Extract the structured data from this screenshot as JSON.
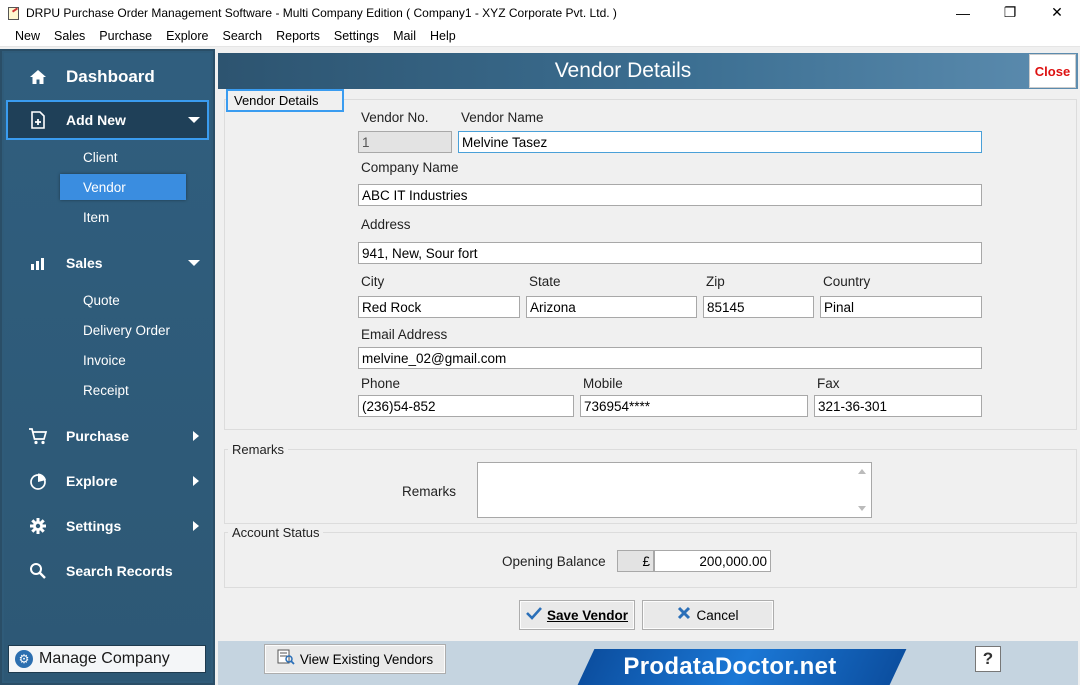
{
  "window": {
    "title": "DRPU Purchase Order Management Software - Multi Company Edition ( Company1 - XYZ Corporate Pvt. Ltd. )",
    "minimize": "—",
    "maximize": "❐",
    "close": "✕"
  },
  "menu": [
    "New",
    "Sales",
    "Purchase",
    "Explore",
    "Search",
    "Reports",
    "Settings",
    "Mail",
    "Help"
  ],
  "sidebar": {
    "dashboard": "Dashboard",
    "add_new": "Add New",
    "add_new_items": [
      "Client",
      "Vendor",
      "Item"
    ],
    "sales": "Sales",
    "sales_items": [
      "Quote",
      "Delivery Order",
      "Invoice",
      "Receipt"
    ],
    "purchase": "Purchase",
    "explore": "Explore",
    "settings": "Settings",
    "search_records": "Search Records",
    "manage_company": "Manage Company"
  },
  "page": {
    "title": "Vendor Details",
    "close_label": "Close"
  },
  "vendor_details": {
    "group_label": "Vendor Details",
    "vendor_no_label": "Vendor No.",
    "vendor_no": "1",
    "vendor_name_label": "Vendor Name",
    "vendor_name": "Melvine Tasez",
    "company_name_label": "Company Name",
    "company_name": "ABC IT Industries",
    "address_label": "Address",
    "address": "941, New, Sour fort",
    "city_label": "City",
    "city": "Red Rock",
    "state_label": "State",
    "state": "Arizona",
    "zip_label": "Zip",
    "zip": "85145",
    "country_label": "Country",
    "country": "Pinal",
    "email_label": "Email Address",
    "email": "melvine_02@gmail.com",
    "phone_label": "Phone",
    "phone": "(236)54-852",
    "mobile_label": "Mobile",
    "mobile": "736954****",
    "fax_label": "Fax",
    "fax": "321-36-301"
  },
  "remarks": {
    "group_label": "Remarks",
    "field_label": "Remarks",
    "value": ""
  },
  "account_status": {
    "group_label": "Account Status",
    "opening_balance_label": "Opening Balance",
    "currency": "£",
    "opening_balance": "200,000.00"
  },
  "actions": {
    "save": "Save Vendor",
    "cancel": "Cancel",
    "view_existing": "View Existing Vendors",
    "help": "?"
  },
  "brand": "ProdataDoctor.net"
}
